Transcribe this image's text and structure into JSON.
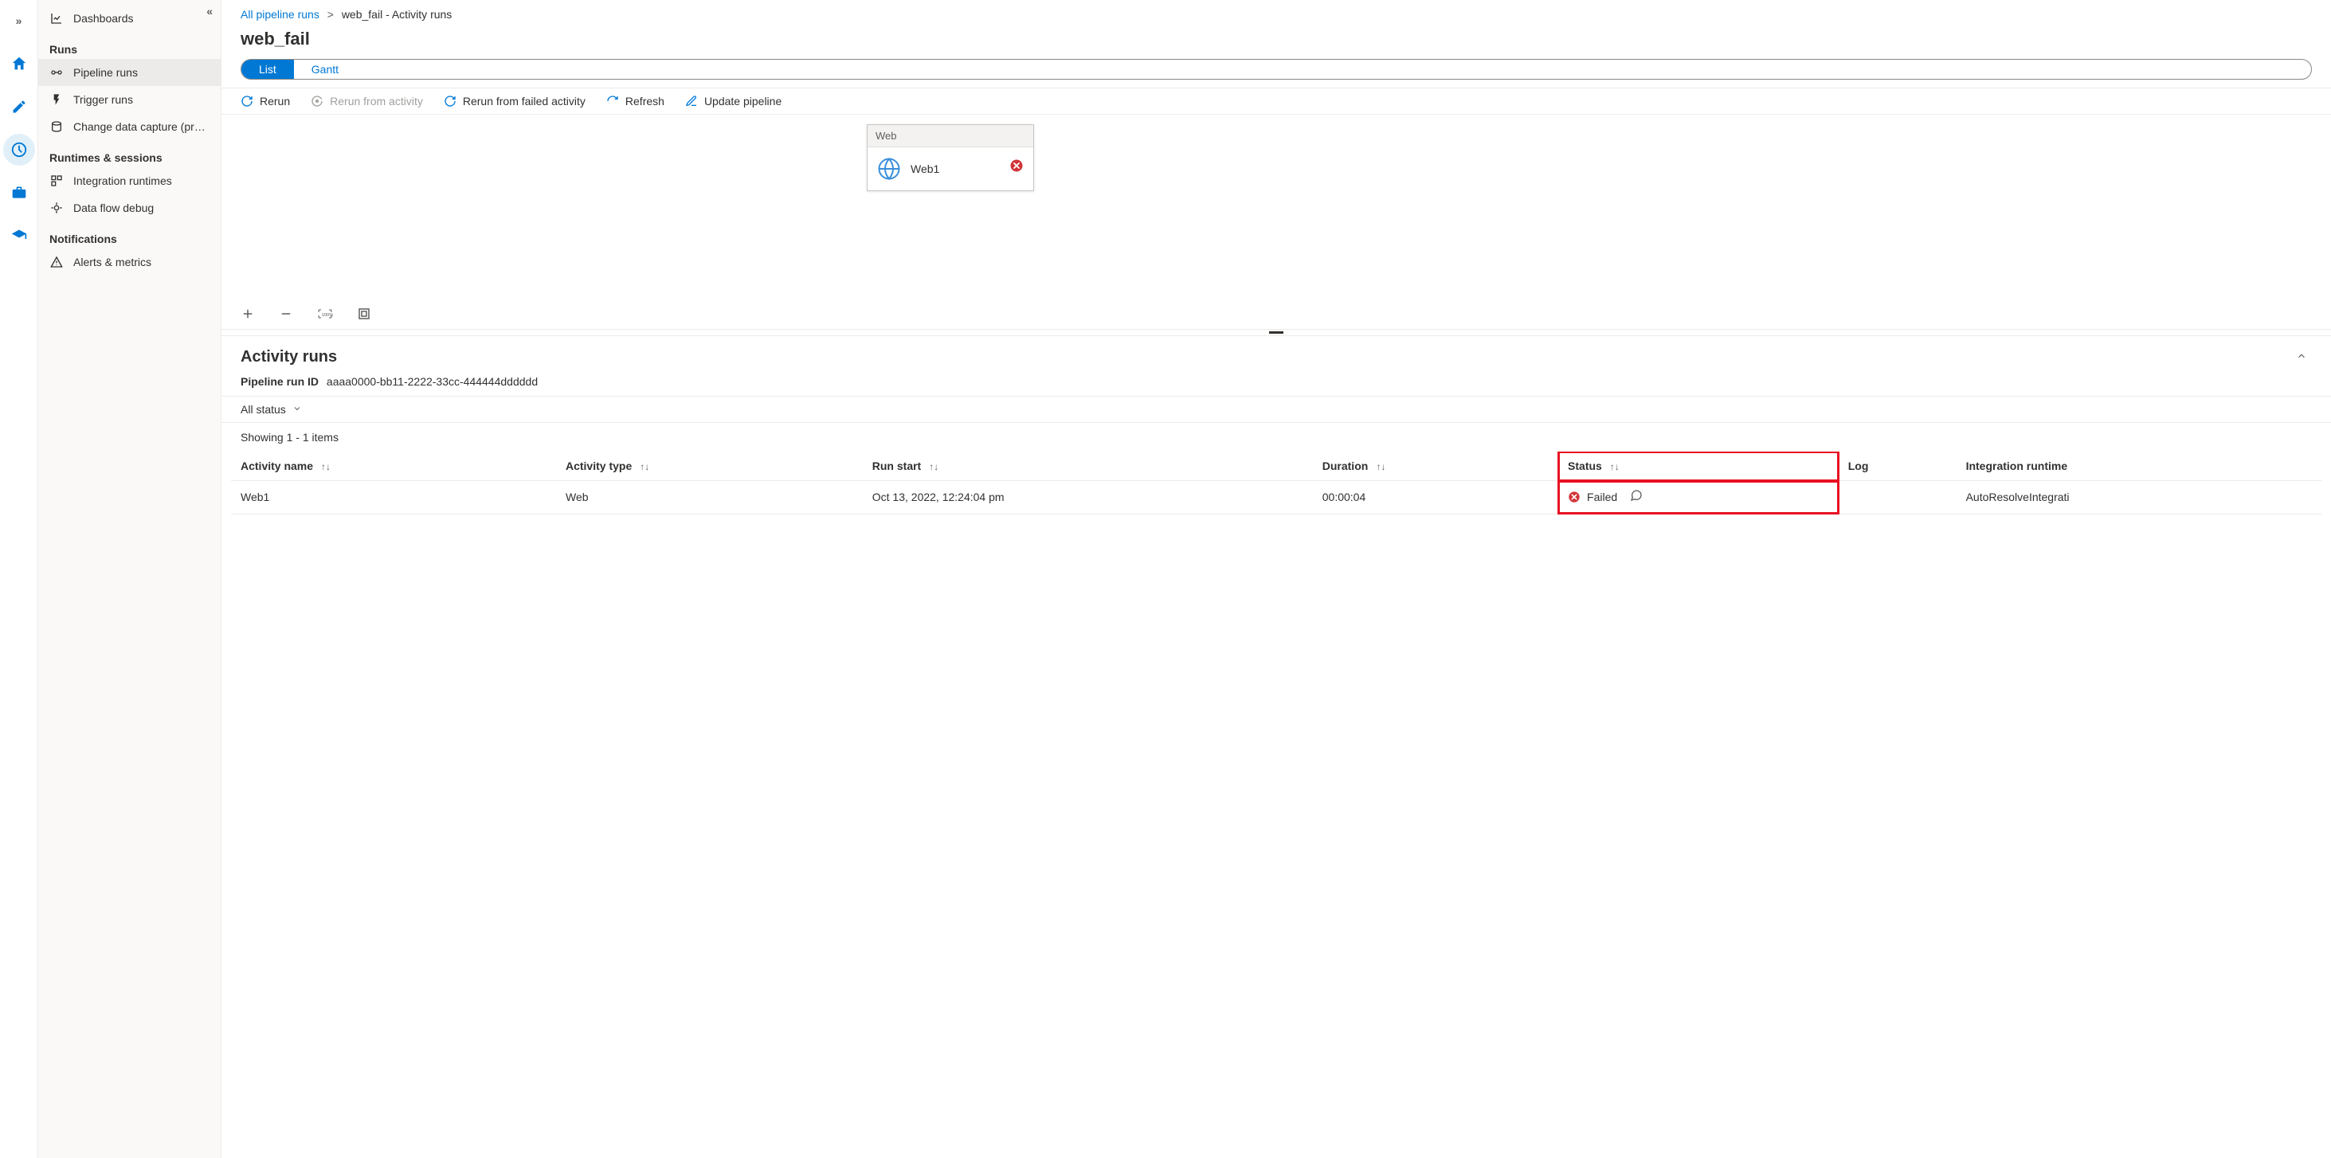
{
  "breadcrumb": {
    "root": "All pipeline runs",
    "current": "web_fail - Activity runs"
  },
  "page_title": "web_fail",
  "view_toggle": {
    "list": "List",
    "gantt": "Gantt"
  },
  "toolbar": {
    "rerun": "Rerun",
    "rerun_from_activity": "Rerun from activity",
    "rerun_from_failed": "Rerun from failed activity",
    "refresh": "Refresh",
    "update_pipeline": "Update pipeline"
  },
  "sidebar": {
    "dashboards": "Dashboards",
    "sections": {
      "runs": "Runs",
      "runtimes": "Runtimes & sessions",
      "notifications": "Notifications"
    },
    "items": {
      "pipeline_runs": "Pipeline runs",
      "trigger_runs": "Trigger runs",
      "cdc": "Change data capture (previ...",
      "integration_runtimes": "Integration runtimes",
      "data_flow_debug": "Data flow debug",
      "alerts": "Alerts & metrics"
    }
  },
  "node": {
    "type": "Web",
    "name": "Web1"
  },
  "activity_runs": {
    "title": "Activity runs",
    "run_id_label": "Pipeline run ID",
    "run_id": "aaaa0000-bb11-2222-33cc-444444dddddd",
    "filter": "All status",
    "count_text": "Showing 1 - 1 items",
    "columns": {
      "activity_name": "Activity name",
      "activity_type": "Activity type",
      "run_start": "Run start",
      "duration": "Duration",
      "status": "Status",
      "log": "Log",
      "integration_runtime": "Integration runtime"
    },
    "rows": [
      {
        "activity_name": "Web1",
        "activity_type": "Web",
        "run_start": "Oct 13, 2022, 12:24:04 pm",
        "duration": "00:00:04",
        "status": "Failed",
        "integration_runtime": "AutoResolveIntegrati"
      }
    ]
  }
}
